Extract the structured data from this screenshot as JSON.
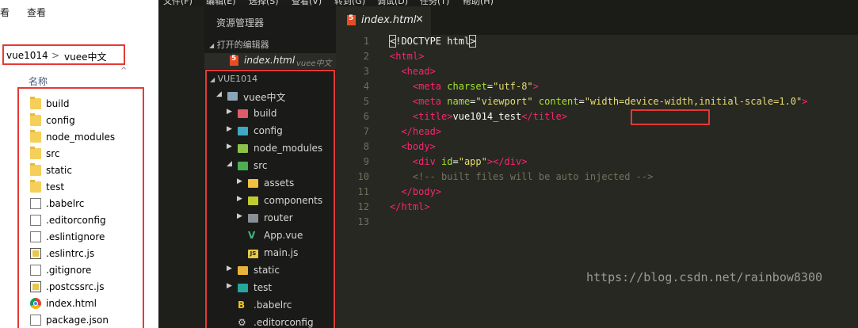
{
  "explorer": {
    "menu": [
      "看",
      "查看"
    ],
    "address": {
      "crumb1": "vue1014",
      "separator": ">",
      "crumb2": "vuee中文"
    },
    "column_header": "名称",
    "files": [
      {
        "name": "build",
        "icon": "folder-icon"
      },
      {
        "name": "config",
        "icon": "folder-icon"
      },
      {
        "name": "node_modules",
        "icon": "folder-icon"
      },
      {
        "name": "src",
        "icon": "folder-icon"
      },
      {
        "name": "static",
        "icon": "folder-icon"
      },
      {
        "name": "test",
        "icon": "folder-icon"
      },
      {
        "name": ".babelrc",
        "icon": "file-icon"
      },
      {
        "name": ".editorconfig",
        "icon": "file-icon"
      },
      {
        "name": ".eslintignore",
        "icon": "file-icon"
      },
      {
        "name": ".eslintrc.js",
        "icon": "js-file-icon"
      },
      {
        "name": ".gitignore",
        "icon": "file-icon"
      },
      {
        "name": ".postcssrc.js",
        "icon": "js-file-icon"
      },
      {
        "name": "index.html",
        "icon": "chrome-icon"
      },
      {
        "name": "package.json",
        "icon": "file-icon"
      }
    ]
  },
  "editor": {
    "menu": [
      "文件(F)",
      "编辑(E)",
      "选择(S)",
      "查看(V)",
      "转到(G)",
      "调试(D)",
      "任务(T)",
      "帮助(H)"
    ],
    "sidebar": {
      "title": "资源管理器",
      "open_editors": "打开的编辑器",
      "open_file": {
        "name": "index.html",
        "path": "vuee中文"
      },
      "root": "VUE1014",
      "tree": [
        {
          "name": "vuee中文",
          "arrow": "◢",
          "icon_color": "#8aa4b8",
          "level": 0
        },
        {
          "name": "build",
          "arrow": "▶",
          "icon_color": "#e05a6a",
          "level": 1
        },
        {
          "name": "config",
          "arrow": "▶",
          "icon_color": "#3fa8c6",
          "level": 1
        },
        {
          "name": "node_modules",
          "arrow": "▶",
          "icon_color": "#8bc34a",
          "level": 1
        },
        {
          "name": "src",
          "arrow": "◢",
          "icon_color": "#4caf50",
          "level": 1
        },
        {
          "name": "assets",
          "arrow": "▶",
          "icon_color": "#f0c040",
          "level": 2
        },
        {
          "name": "components",
          "arrow": "▶",
          "icon_color": "#c0ca33",
          "level": 2
        },
        {
          "name": "router",
          "arrow": "▶",
          "icon_color": "#8a8f96",
          "level": 2
        },
        {
          "name": "App.vue",
          "arrow": "",
          "icon_color": "#41b883",
          "level": 2,
          "glyph": "V"
        },
        {
          "name": "main.js",
          "arrow": "",
          "icon_color": "#e6c84a",
          "level": 2,
          "glyph": "JS"
        },
        {
          "name": "static",
          "arrow": "▶",
          "icon_color": "#e6b43a",
          "level": 1
        },
        {
          "name": "test",
          "arrow": "▶",
          "icon_color": "#26a69a",
          "level": 1
        },
        {
          "name": ".babelrc",
          "arrow": "",
          "icon_color": "#f5c518",
          "level": 1,
          "glyph": "B"
        },
        {
          "name": ".editorconfig",
          "arrow": "",
          "icon_color": "#cccccc",
          "level": 1,
          "glyph": "⚙"
        }
      ]
    },
    "tab": {
      "name": "index.html",
      "close": "×"
    },
    "code_lines": [
      [
        "1",
        "<!DOCTYPE html>"
      ],
      [
        "2",
        "<html>"
      ],
      [
        "3",
        "  <head>"
      ],
      [
        "4",
        "    <meta charset=\"utf-8\">"
      ],
      [
        "5",
        "    <meta name=\"viewport\" content=\"width=device-width,initial-scale=1.0\">"
      ],
      [
        "6",
        "    <title>vue1014_test</title>"
      ],
      [
        "7",
        "  </head>"
      ],
      [
        "8",
        "  <body>"
      ],
      [
        "9",
        "    <div id=\"app\"></div>"
      ],
      [
        "10",
        "    <!-- built files will be auto injected -->"
      ],
      [
        "11",
        "  </body>"
      ],
      [
        "12",
        "</html>"
      ],
      [
        "13",
        ""
      ]
    ],
    "highlighted_title": "vue1014_test"
  },
  "watermark": "https://blog.csdn.net/rainbow8300"
}
